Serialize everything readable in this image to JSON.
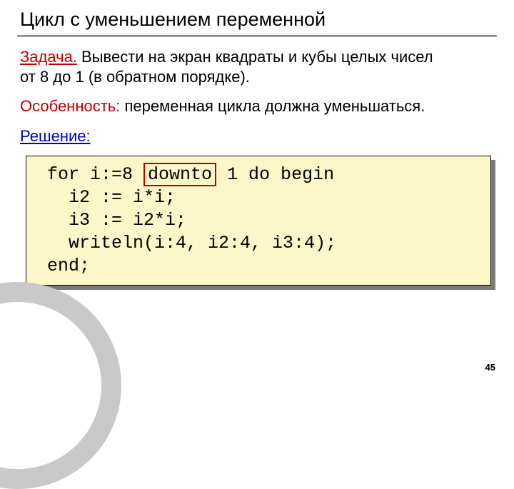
{
  "title": "Цикл с уменьшением переменной",
  "task": {
    "label": "Задача.",
    "text_a": " Вывести на экран квадраты и кубы целых чисел",
    "text_b": "от 8 до 1 (в обратном порядке)."
  },
  "feature": {
    "label": "Особенность:",
    "text": " переменная цикла должна уменьшаться."
  },
  "solution": {
    "label": "Решение:"
  },
  "code": {
    "l1a": " for i:=8 ",
    "kw": "downto",
    "l1b": " 1 do begin",
    "l2": "   i2 := i*i;",
    "l3": "   i3 := i2*i;",
    "l4": "   writeln(i:4, i2:4, i3:4);",
    "l5": " end;"
  },
  "page_number": "45"
}
